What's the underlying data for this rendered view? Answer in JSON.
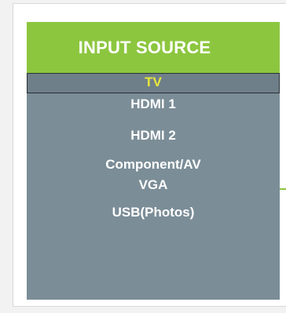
{
  "menu": {
    "title": "INPUT SOURCE",
    "items": [
      {
        "label": "TV",
        "selected": true
      },
      {
        "label": "HDMI 1",
        "selected": false
      },
      {
        "label": "HDMI 2",
        "selected": false
      },
      {
        "label": "Component/AV",
        "selected": false
      },
      {
        "label": "VGA",
        "selected": false
      },
      {
        "label": "USB(Photos)",
        "selected": false
      }
    ]
  },
  "colors": {
    "header_bg": "#8cc63f",
    "panel_bg": "#7b8d97",
    "selected_text": "#e8e83a",
    "text": "#ffffff"
  }
}
